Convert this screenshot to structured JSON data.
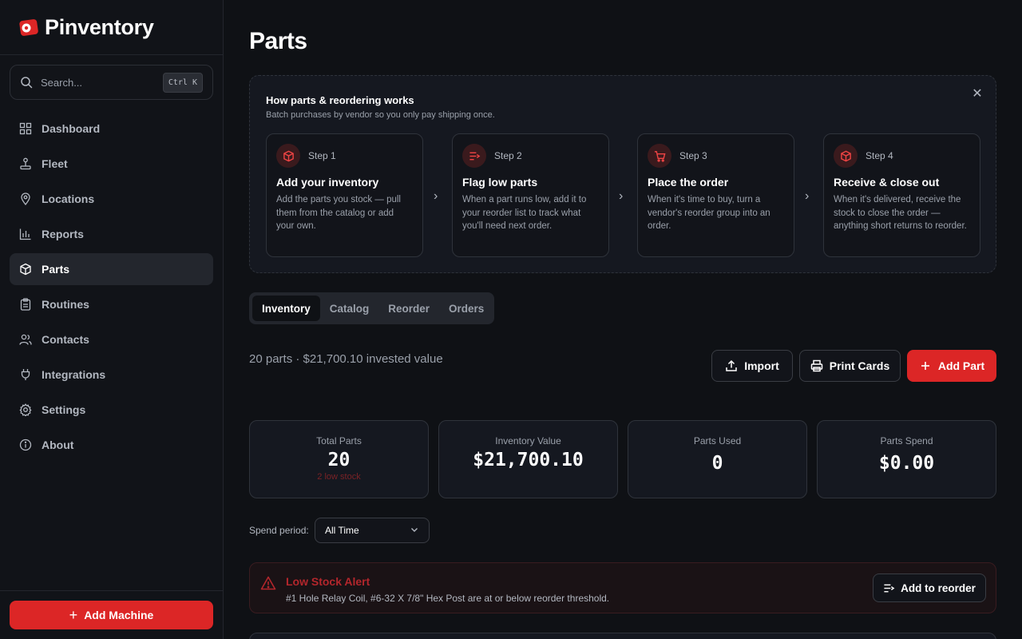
{
  "brand": {
    "name": "Pinventory"
  },
  "search": {
    "placeholder": "Search...",
    "shortcut": "Ctrl K"
  },
  "nav": {
    "items": [
      {
        "label": "Dashboard",
        "icon": "grid-icon"
      },
      {
        "label": "Fleet",
        "icon": "joystick-icon"
      },
      {
        "label": "Locations",
        "icon": "map-pin-icon"
      },
      {
        "label": "Reports",
        "icon": "bar-chart-icon"
      },
      {
        "label": "Parts",
        "icon": "box-icon",
        "active": true
      },
      {
        "label": "Routines",
        "icon": "clipboard-icon"
      },
      {
        "label": "Contacts",
        "icon": "users-icon"
      },
      {
        "label": "Integrations",
        "icon": "plug-icon"
      },
      {
        "label": "Settings",
        "icon": "gear-icon"
      },
      {
        "label": "About",
        "icon": "info-icon"
      }
    ]
  },
  "sidebar_footer": {
    "add_machine_label": "Add Machine"
  },
  "page": {
    "title": "Parts"
  },
  "guide": {
    "title": "How parts & reordering works",
    "subtitle": "Batch purchases by vendor so you only pay shipping once.",
    "steps": [
      {
        "num": "Step 1",
        "title": "Add your inventory",
        "desc": "Add the parts you stock — pull them from the catalog or add your own.",
        "icon": "box-icon"
      },
      {
        "num": "Step 2",
        "title": "Flag low parts",
        "desc": "When a part runs low, add it to your reorder list to track what you'll need next order.",
        "icon": "list-plus-icon"
      },
      {
        "num": "Step 3",
        "title": "Place the order",
        "desc": "When it's time to buy, turn a vendor's reorder group into an order.",
        "icon": "cart-icon"
      },
      {
        "num": "Step 4",
        "title": "Receive & close out",
        "desc": "When it's delivered, receive the stock to close the order — anything short returns to reorder.",
        "icon": "box-icon"
      }
    ]
  },
  "tabs": [
    {
      "label": "Inventory",
      "active": true
    },
    {
      "label": "Catalog"
    },
    {
      "label": "Reorder"
    },
    {
      "label": "Orders"
    }
  ],
  "summary": "20 parts · $21,700.10 invested value",
  "actions": {
    "import": "Import",
    "print_cards": "Print Cards",
    "add_part": "Add Part"
  },
  "stats": [
    {
      "label": "Total Parts",
      "value": "20",
      "sub": "2 low stock"
    },
    {
      "label": "Inventory Value",
      "value": "$21,700.10"
    },
    {
      "label": "Parts Used",
      "value": "0"
    },
    {
      "label": "Parts Spend",
      "value": "$0.00"
    }
  ],
  "spend_period": {
    "label": "Spend period:",
    "value": "All Time"
  },
  "alert": {
    "title": "Low Stock Alert",
    "desc": "#1 Hole Relay Coil, #6-32 X 7/8\" Hex Post are at or below reorder threshold.",
    "button": "Add to reorder"
  },
  "colors": {
    "accent": "#dc2626",
    "background": "#0f1115",
    "sidebar": "#111318",
    "card": "#151820"
  }
}
